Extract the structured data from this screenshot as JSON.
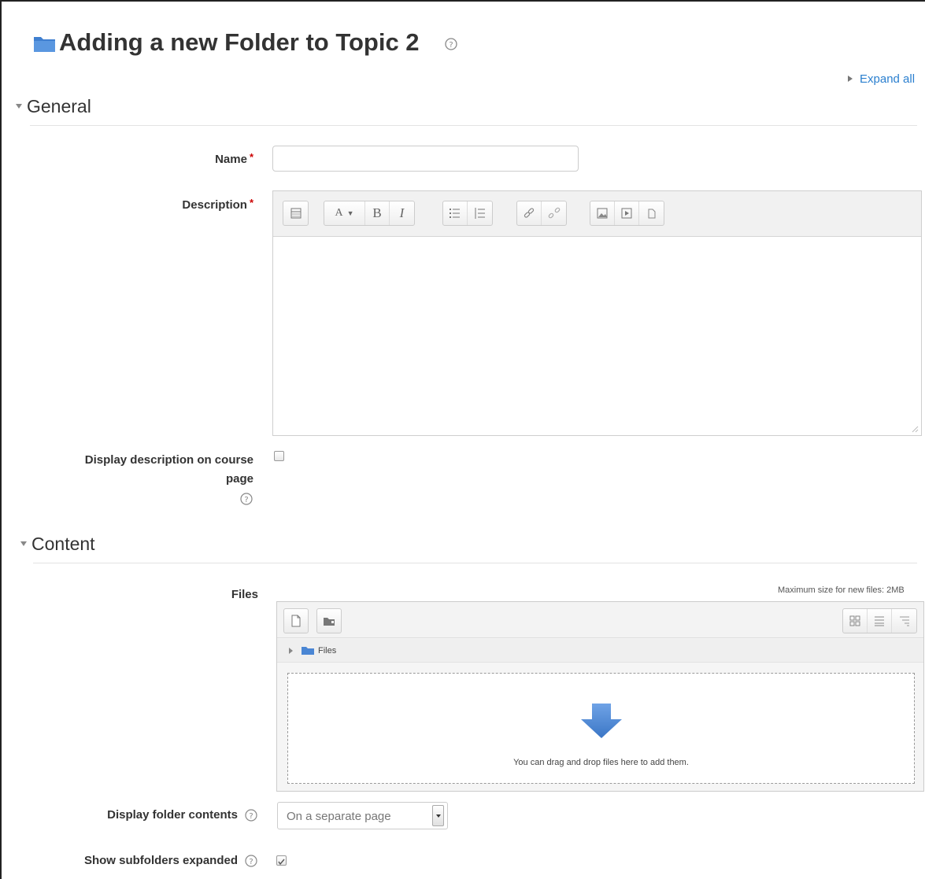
{
  "page": {
    "title": "Adding a new Folder to Topic 2",
    "expand_all": "Expand all"
  },
  "colors": {
    "folder_icon": "#4a86d4",
    "link": "#2a7fcf",
    "required": "#cc0000",
    "drop_arrow": "#4a86d4"
  },
  "general": {
    "heading": "General",
    "name_label": "Name",
    "name_value": "",
    "description_label": "Description",
    "required_mark": "*",
    "display_description_label_line1": "Display description on course",
    "display_description_label_line2": "page",
    "display_description_checked": false
  },
  "editor_toolbar": {
    "groups": [
      [
        "collapse-icon"
      ],
      [
        "font-size-dropdown-icon",
        "bold-icon",
        "italic-icon"
      ],
      [
        "unordered-list-icon",
        "ordered-list-icon"
      ],
      [
        "link-icon",
        "unlink-icon"
      ],
      [
        "image-icon",
        "media-icon",
        "manage-files-icon"
      ]
    ],
    "font_size_glyph": "A",
    "bold_glyph": "B",
    "italic_glyph": "I"
  },
  "content": {
    "heading": "Content",
    "files_label": "Files",
    "max_size": "Maximum size for new files: 2MB",
    "path_root": "Files",
    "drop_text": "You can drag and drop files here to add them.",
    "display_folder_contents_label": "Display folder contents",
    "display_folder_contents_value": "On a separate page",
    "show_subfolders_label": "Show subfolders expanded",
    "show_subfolders_checked": true
  }
}
